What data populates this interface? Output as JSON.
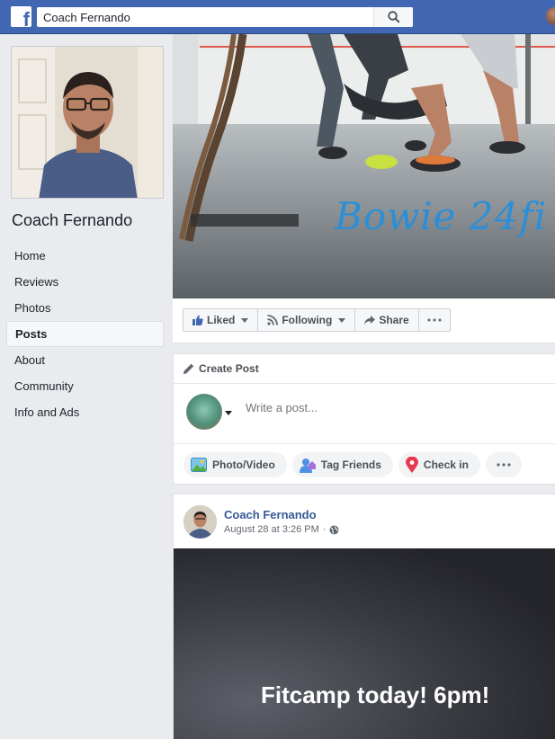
{
  "topbar": {
    "search_value": "Coach Fernando"
  },
  "sidebar": {
    "page_name": "Coach Fernando",
    "items": [
      {
        "label": "Home"
      },
      {
        "label": "Reviews"
      },
      {
        "label": "Photos"
      },
      {
        "label": "Posts"
      },
      {
        "label": "About"
      },
      {
        "label": "Community"
      },
      {
        "label": "Info and Ads"
      }
    ],
    "active_item": "Posts"
  },
  "cover": {
    "text": "Bowie 24fi"
  },
  "actions": {
    "liked": "Liked",
    "following": "Following",
    "share": "Share"
  },
  "composer": {
    "title": "Create Post",
    "placeholder": "Write a post...",
    "photo_video": "Photo/Video",
    "tag_friends": "Tag Friends",
    "check_in": "Check in"
  },
  "post": {
    "author": "Coach Fernando",
    "timestamp": "August 28 at 3:26 PM",
    "separator": "·",
    "image_text": "Fitcamp today! 6pm!"
  },
  "colors": {
    "brand_blue": "#4267b2",
    "link_blue": "#365899",
    "background": "#e9ebee"
  }
}
